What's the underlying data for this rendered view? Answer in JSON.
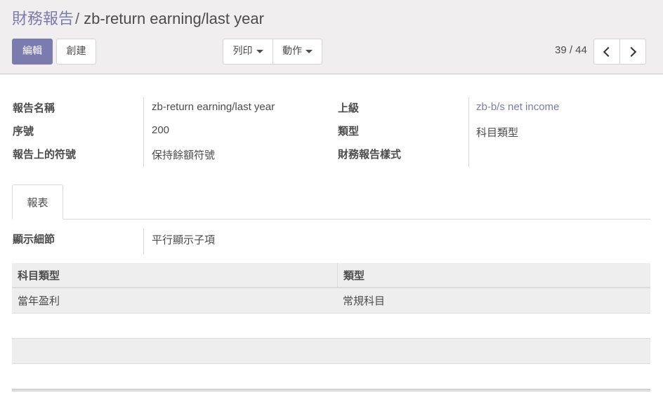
{
  "breadcrumb": {
    "parent": "財務報告",
    "separator": "/",
    "current": "zb-return earning/last year"
  },
  "toolbar": {
    "edit_label": "編輯",
    "create_label": "創建",
    "print_label": "列印",
    "action_label": "動作"
  },
  "pager": {
    "value": "39 / 44",
    "current": 39,
    "total": 44
  },
  "form": {
    "report_name_label": "報告名稱",
    "report_name_value": "zb-return earning/last year",
    "sequence_label": "序號",
    "sequence_value": "200",
    "sign_label": "報告上的符號",
    "sign_value": "保持餘額符號",
    "parent_label": "上級",
    "parent_value": "zb-b/s net income",
    "type_label": "類型",
    "type_value": "科目類型",
    "style_label": "財務報告樣式",
    "style_value": ""
  },
  "tabs": [
    {
      "label": "報表"
    }
  ],
  "report_tab": {
    "display_detail_label": "顯示細節",
    "display_detail_value": "平行顯示子項",
    "table": {
      "columns": [
        "科目類型",
        "類型"
      ],
      "rows": [
        [
          "當年盈利",
          "常規科目"
        ]
      ]
    }
  },
  "colors": {
    "primary": "#7c7bad",
    "panel_bg": "#f0eeee"
  }
}
